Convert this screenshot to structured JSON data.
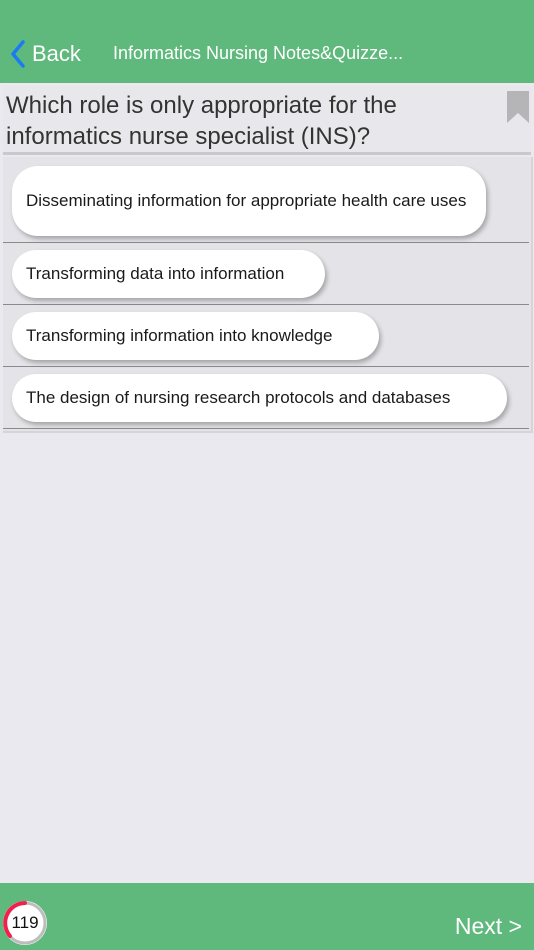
{
  "nav": {
    "back_label": "Back",
    "title": "Informatics Nursing Notes&Quizze..."
  },
  "question": {
    "text": "Which role is only appropriate for the informatics nurse specialist (INS)?"
  },
  "answers": [
    {
      "label": "Disseminating information for appropriate health care uses"
    },
    {
      "label": "Transforming data into information"
    },
    {
      "label": "Transforming information into knowledge"
    },
    {
      "label": "The design of nursing research protocols and databases"
    }
  ],
  "footer": {
    "counter": "119",
    "next_label": "Next >"
  },
  "icons": {
    "back": "chevron-left-icon",
    "bookmark": "bookmark-icon",
    "progress": "progress-ring-icon"
  },
  "colors": {
    "bar_green": "#5fb87c",
    "back_blue": "#1a7cf5",
    "progress_red": "#f0214a",
    "background": "#eae9ef"
  }
}
